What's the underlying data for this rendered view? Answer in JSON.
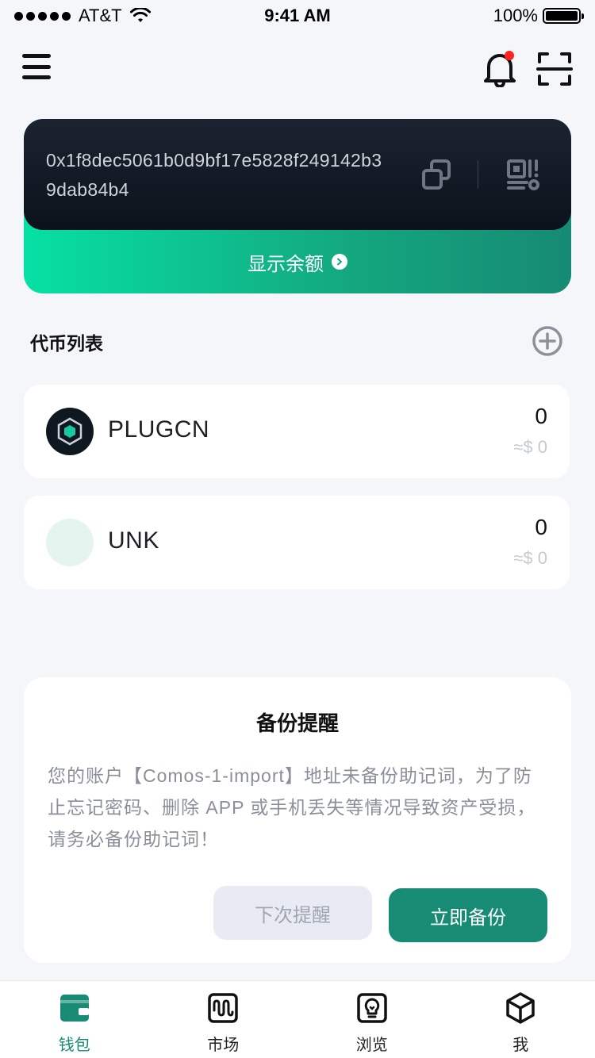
{
  "status_bar": {
    "carrier": "AT&T",
    "time": "9:41 AM",
    "battery": "100%"
  },
  "header": {
    "icons": [
      "menu-icon",
      "bell-icon",
      "scan-icon"
    ],
    "has_notification_dot": true
  },
  "wallet": {
    "address": "0x1f8dec5061b0d9bf17e5828f249142b39dab84b4",
    "show_balance_label": "显示余额"
  },
  "tokens": {
    "title": "代币列表",
    "items": [
      {
        "name": "PLUGCN",
        "amount": "0",
        "value": "≈$ 0"
      },
      {
        "name": "UNK",
        "amount": "0",
        "value": "≈$ 0"
      }
    ]
  },
  "backup": {
    "title": "备份提醒",
    "message": "您的账户【Comos-1-import】地址未备份助记词，为了防止忘记密码、删除 APP 或手机丢失等情况导致资产受损，请务必备份助记词！",
    "later_label": "下次提醒",
    "backup_label": "立即备份"
  },
  "tabs": [
    {
      "label": "钱包",
      "icon": "wallet-icon",
      "active": true
    },
    {
      "label": "市场",
      "icon": "market-icon",
      "active": false
    },
    {
      "label": "浏览",
      "icon": "browse-icon",
      "active": false
    },
    {
      "label": "我",
      "icon": "profile-icon",
      "active": false
    }
  ],
  "colors": {
    "accent": "#178b73",
    "accent_light": "#06e0a4",
    "notification_dot": "#ff2020",
    "card_dark": "#0c121b"
  }
}
